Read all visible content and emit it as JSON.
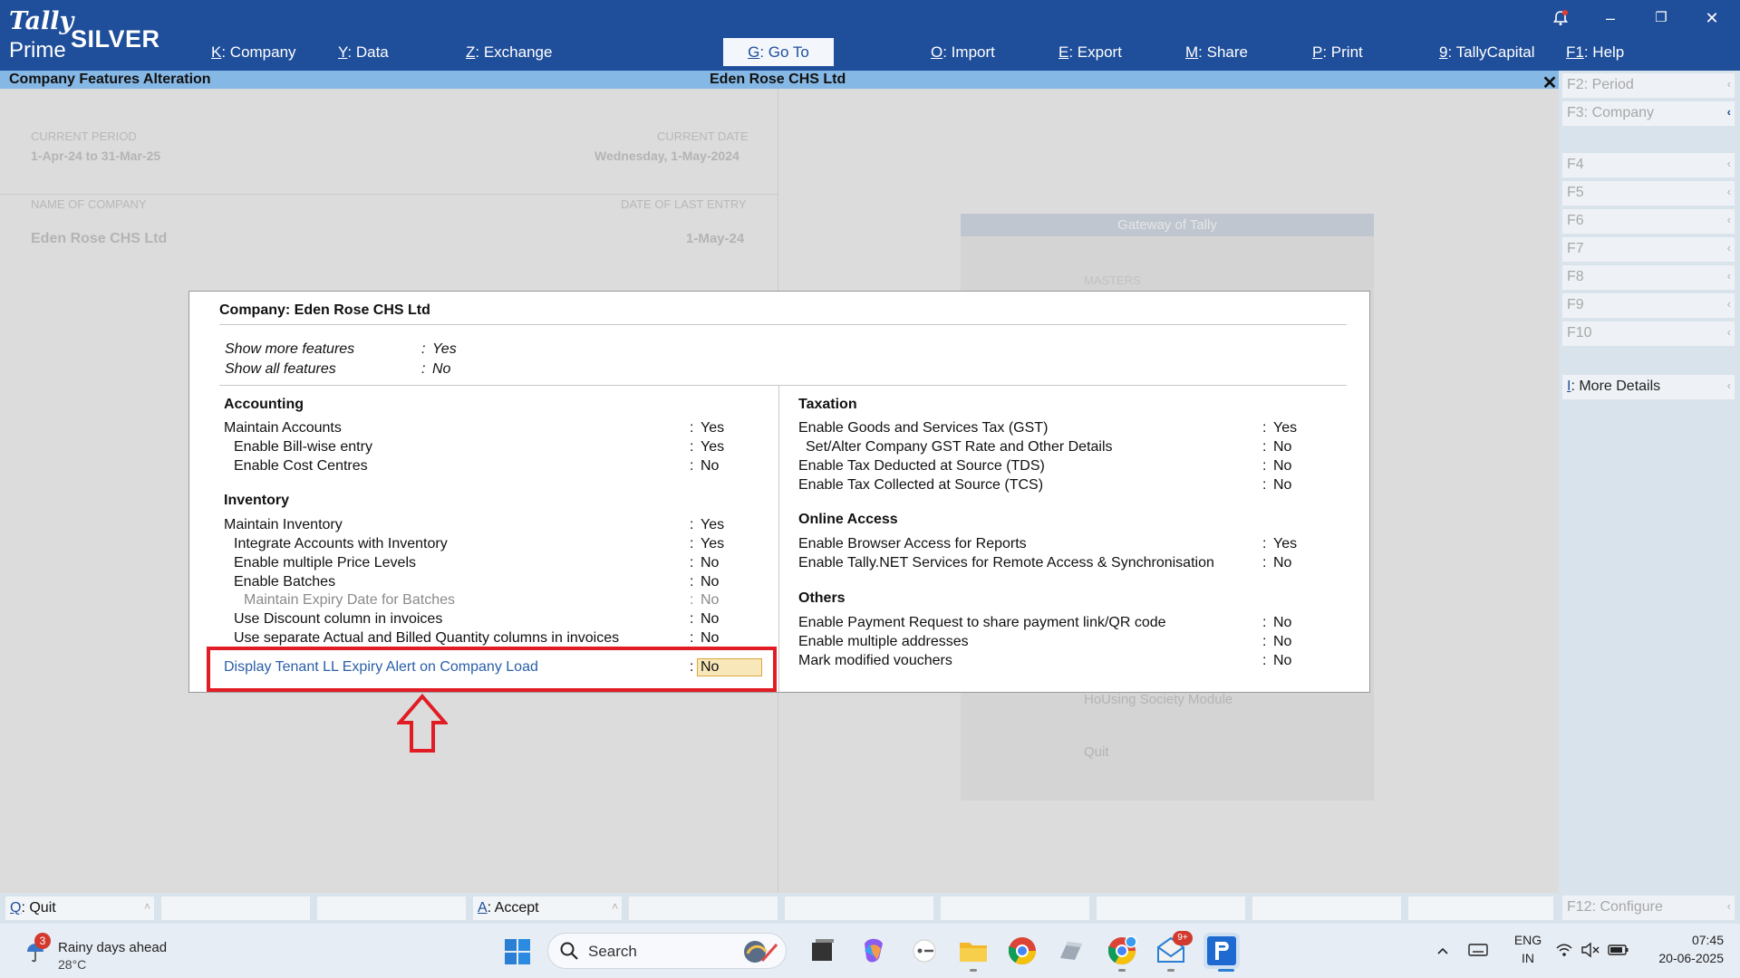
{
  "app": {
    "logo_tally": "Tally",
    "logo_prime": "Prime",
    "edition": "SILVER"
  },
  "menu": [
    {
      "key": "K",
      "label": ": Company"
    },
    {
      "key": "Y",
      "label": ": Data"
    },
    {
      "key": "Z",
      "label": ": Exchange"
    },
    {
      "key": "G",
      "label": ": Go To"
    },
    {
      "key": "O",
      "label": ": Import"
    },
    {
      "key": "E",
      "label": ": Export"
    },
    {
      "key": "M",
      "label": ": Share"
    },
    {
      "key": "P",
      "label": ": Print"
    },
    {
      "key": "9",
      "label": ": TallyCapital"
    },
    {
      "key": "F1",
      "label": ": Help"
    }
  ],
  "window": {
    "minimize": "–",
    "restore": "❐",
    "close": "✕"
  },
  "title_strip": {
    "screen": "Company Features  Alteration",
    "company": "Eden Rose CHS Ltd",
    "close": "✕"
  },
  "background": {
    "current_period_label": "CURRENT PERIOD",
    "current_period": "1-Apr-24 to 31-Mar-25",
    "current_date_label": "CURRENT DATE",
    "current_date": "Wednesday, 1-May-2024",
    "name_of_company_label": "NAME OF COMPANY",
    "date_of_last_entry_label": "DATE OF LAST ENTRY",
    "company_name": "Eden Rose CHS Ltd",
    "last_entry": "1-May-24",
    "gateway_title": "Gateway of Tally",
    "gateway_masters": "MASTERS",
    "gateway_housing": "HoUsing Society Module",
    "gateway_quit": "Quit"
  },
  "dialog": {
    "title": "Company: Eden Rose CHS Ltd",
    "top": [
      {
        "label": "Show more features",
        "value": "Yes"
      },
      {
        "label": "Show all features",
        "value": "No"
      }
    ],
    "accounting": {
      "heading": "Accounting",
      "rows": [
        {
          "label": "Maintain Accounts",
          "value": "Yes"
        },
        {
          "label": "Enable Bill-wise entry",
          "value": "Yes"
        },
        {
          "label": "Enable Cost Centres",
          "value": "No"
        }
      ]
    },
    "inventory": {
      "heading": "Inventory",
      "rows": [
        {
          "label": "Maintain Inventory",
          "value": "Yes"
        },
        {
          "label": "Integrate Accounts with Inventory",
          "value": "Yes"
        },
        {
          "label": "Enable multiple Price Levels",
          "value": "No"
        },
        {
          "label": "Enable Batches",
          "value": "No"
        },
        {
          "label": "Maintain Expiry Date for Batches",
          "value": "No"
        },
        {
          "label": "Use Discount column in invoices",
          "value": "No"
        },
        {
          "label": "Use separate Actual and Billed Quantity columns in invoices",
          "value": "No"
        }
      ]
    },
    "custom": {
      "label": "Display Tenant LL Expiry Alert on Company Load",
      "value": "No"
    },
    "taxation": {
      "heading": "Taxation",
      "rows": [
        {
          "label": "Enable Goods and Services Tax (GST)",
          "value": "Yes"
        },
        {
          "label": "Set/Alter Company GST Rate and Other Details",
          "value": "No"
        },
        {
          "label": "Enable Tax Deducted at Source (TDS)",
          "value": "No"
        },
        {
          "label": "Enable Tax Collected at Source (TCS)",
          "value": "No"
        }
      ]
    },
    "online": {
      "heading": "Online Access",
      "rows": [
        {
          "label": "Enable Browser Access for Reports",
          "value": "Yes"
        },
        {
          "label": "Enable Tally.NET Services for Remote Access & Synchronisation",
          "value": "No"
        }
      ]
    },
    "others": {
      "heading": "Others",
      "rows": [
        {
          "label": "Enable Payment Request to share payment link/QR code",
          "value": "No"
        },
        {
          "label": "Enable multiple addresses",
          "value": "No"
        },
        {
          "label": "Mark modified vouchers",
          "value": "No"
        }
      ]
    },
    "colon": ":"
  },
  "right_panel": [
    {
      "key": "F2",
      "label": ": Period"
    },
    {
      "key": "F3",
      "label": ": Company"
    },
    {
      "key": "F4",
      "label": ""
    },
    {
      "key": "F5",
      "label": ""
    },
    {
      "key": "F6",
      "label": ""
    },
    {
      "key": "F7",
      "label": ""
    },
    {
      "key": "F8",
      "label": ""
    },
    {
      "key": "F9",
      "label": ""
    },
    {
      "key": "F10",
      "label": ""
    },
    {
      "key": "I",
      "label": ": More Details"
    },
    {
      "key": "F12",
      "label": ": Configure"
    }
  ],
  "bottom_bar": [
    {
      "key": "Q",
      "label": ": Quit"
    },
    {
      "key": "A",
      "label": ": Accept"
    }
  ],
  "taskbar": {
    "weather_badge": "3",
    "weather_text": "Rainy days ahead",
    "weather_temp": "28°C",
    "search": "Search",
    "lang": "ENG",
    "region": "IN",
    "time": "07:45",
    "date": "20-06-2025",
    "mail_badge": "9+"
  },
  "colors": {
    "topbar": "#1f4e9a",
    "title_strip": "#86b8e6",
    "highlight": "#e11c24",
    "field_bg": "#f8e7b8"
  }
}
